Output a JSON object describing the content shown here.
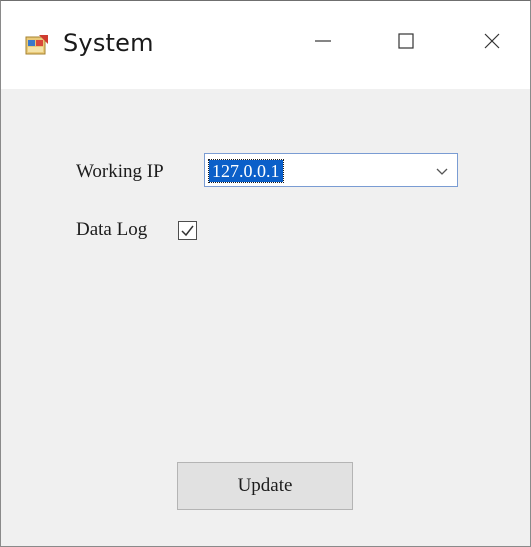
{
  "window": {
    "title": "System",
    "icon": "app-window-icon",
    "controls": {
      "minimize": "minimize-icon",
      "maximize": "maximize-icon",
      "close": "close-icon"
    }
  },
  "form": {
    "working_ip": {
      "label": "Working IP",
      "value": "127.0.0.1"
    },
    "data_log": {
      "label": "Data Log",
      "checked": true
    },
    "update_button": {
      "label": "Update"
    }
  },
  "colors": {
    "selection": "#0b5fc9",
    "window_bg": "#f0f0f0",
    "button_bg": "#e1e1e1"
  }
}
